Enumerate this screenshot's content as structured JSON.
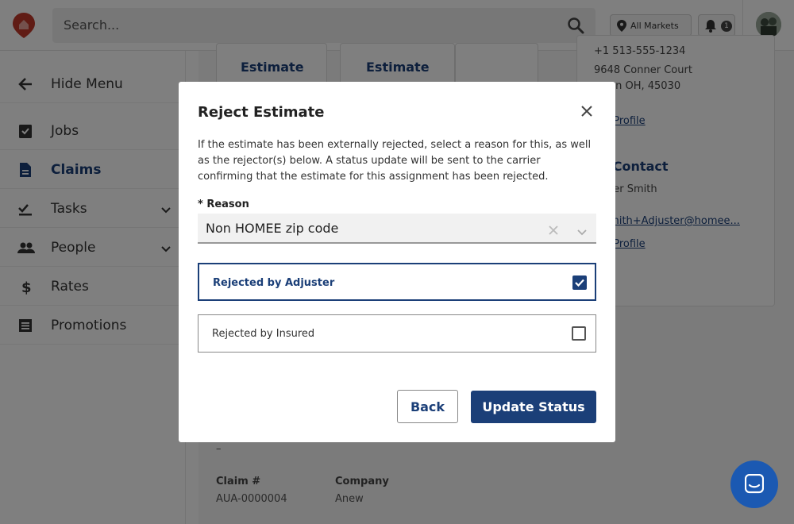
{
  "topbar": {
    "search_placeholder": "Search...",
    "markets_label": "All Markets",
    "notification_count": "1"
  },
  "sidebar": {
    "items": [
      {
        "label": "Hide Menu",
        "icon": "arrow-left-icon"
      },
      {
        "label": "Jobs",
        "icon": "clipboard-check-icon"
      },
      {
        "label": "Claims",
        "icon": "document-icon",
        "active": true
      },
      {
        "label": "Tasks",
        "icon": "checklist-icon",
        "expandable": true
      },
      {
        "label": "People",
        "icon": "people-icon",
        "expandable": true
      },
      {
        "label": "Rates",
        "icon": "dollar-icon"
      },
      {
        "label": "Promotions",
        "icon": "list-icon"
      }
    ]
  },
  "background": {
    "estimate_cards": [
      "Estimate",
      "Estimate"
    ],
    "contact": {
      "phone": "+1 513-555-1234",
      "street": "9648 Conner Court",
      "city": "...son OH, 45030",
      "view_profile": "...y Profile",
      "heading": "... Contact",
      "name": "...ster Smith",
      "email": "...smith+Adjuster@homee...",
      "view_profile_2": "...y Profile"
    },
    "claim_label": "Claim #",
    "claim_value": "AUA-0000004",
    "company_label": "Company",
    "company_value": "Anew",
    "dash": "–"
  },
  "modal": {
    "title": "Reject Estimate",
    "description": "If the estimate has been externally rejected, select a reason for this, as well as the rejector(s) below. A status update will be sent to the carrier confirming that the estimate for this assignment has been rejected.",
    "reason_label": "* Reason",
    "reason_value": "Non HOMEE zip code",
    "options": [
      {
        "label": "Rejected by Adjuster",
        "checked": true
      },
      {
        "label": "Rejected by Insured",
        "checked": false
      }
    ],
    "back_label": "Back",
    "update_label": "Update Status"
  },
  "colors": {
    "primary": "#1b3f78",
    "chat": "#1b59b2"
  }
}
